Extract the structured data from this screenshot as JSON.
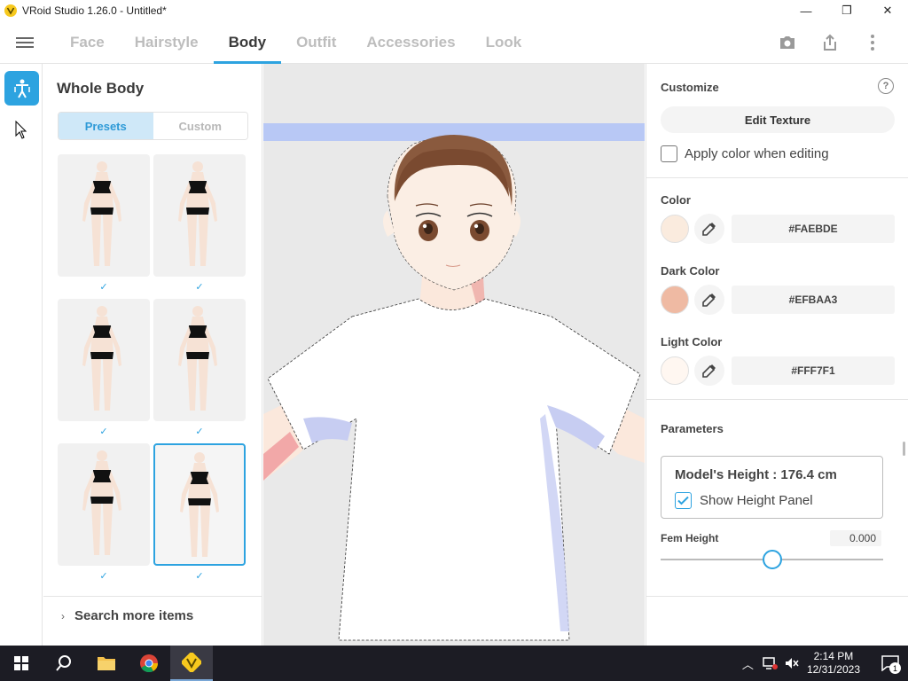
{
  "window": {
    "title": "VRoid Studio 1.26.0 - Untitled*",
    "min_glyph": "—",
    "max_glyph": "❐",
    "close_glyph": "✕"
  },
  "tabs": [
    {
      "label": "Face",
      "active": false
    },
    {
      "label": "Hairstyle",
      "active": false
    },
    {
      "label": "Body",
      "active": true
    },
    {
      "label": "Outfit",
      "active": false
    },
    {
      "label": "Accessories",
      "active": false
    },
    {
      "label": "Look",
      "active": false
    }
  ],
  "top_icons": [
    "camera-icon",
    "share-icon",
    "more-vertical-icon"
  ],
  "left_panel": {
    "title": "Whole Body",
    "segments": {
      "presets": "Presets",
      "custom": "Custom",
      "active": "presets"
    },
    "check_glyph": "✓",
    "presets_count": 6,
    "selected_index": 5,
    "search_more_chevron": "›",
    "search_more": "Search more items"
  },
  "customize": {
    "title": "Customize",
    "help_glyph": "?",
    "edit_texture": "Edit Texture",
    "apply_color_label": "Apply color when editing",
    "apply_color_checked": false
  },
  "colors": [
    {
      "label": "Color",
      "hex": "#FAEBDE",
      "swatch": "#FAEBDE"
    },
    {
      "label": "Dark Color",
      "hex": "#EFBAA3",
      "swatch": "#EFBAA3"
    },
    {
      "label": "Light Color",
      "hex": "#FFF7F1",
      "swatch": "#FFF7F1"
    }
  ],
  "parameters": {
    "title": "Parameters",
    "model_height": "Model's Height : 176.4 cm",
    "show_height_panel": "Show Height Panel",
    "show_height_checked": true,
    "fem_height_label": "Fem Height",
    "fem_height_value": "0.000",
    "fem_height_fraction": 0.5
  },
  "taskbar": {
    "time": "2:14 PM",
    "date": "12/31/2023",
    "tray_chevron": "︿",
    "notification_count": "1"
  },
  "accent": "#2DA3E0"
}
